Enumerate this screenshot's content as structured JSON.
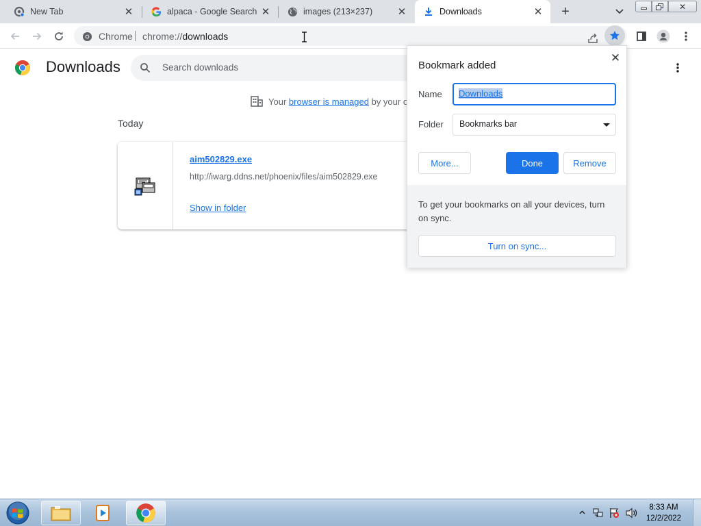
{
  "tabs": [
    {
      "label": "New Tab",
      "icon": "chrome-settings-icon",
      "active": false
    },
    {
      "label": "alpaca - Google Search",
      "icon": "google-g-icon",
      "active": false
    },
    {
      "label": "images (213×237)",
      "icon": "globe-icon",
      "active": false
    },
    {
      "label": "Downloads",
      "icon": "download-icon",
      "active": true
    }
  ],
  "toolbar": {
    "site_chip": "Chrome",
    "url_scheme": "chrome://",
    "url_host": "downloads"
  },
  "page": {
    "title": "Downloads",
    "search_placeholder": "Search downloads",
    "managed_prefix": "Your",
    "managed_link": "browser is managed",
    "managed_suffix": "by your o",
    "section_label": "Today",
    "download": {
      "filename": "aim502829.exe",
      "url": "http://iwarg.ddns.net/phoenix/files/aim502829.exe",
      "action": "Show in folder"
    }
  },
  "bookmark_bubble": {
    "title": "Bookmark added",
    "name_label": "Name",
    "name_value": "Downloads",
    "folder_label": "Folder",
    "folder_value": "Bookmarks bar",
    "more_label": "More...",
    "done_label": "Done",
    "remove_label": "Remove",
    "sync_text": "To get your bookmarks on all your devices, turn on sync.",
    "sync_button": "Turn on sync..."
  },
  "taskbar": {
    "time": "8:33 AM",
    "date": "12/2/2022"
  },
  "colors": {
    "accent": "#1a73e8",
    "tabstrip": "#dee1e6"
  }
}
